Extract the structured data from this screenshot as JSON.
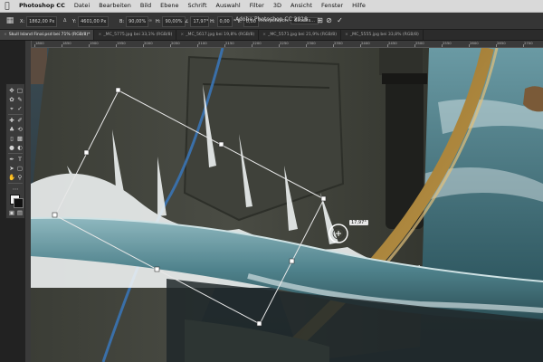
{
  "menubar": {
    "app": "Photoshop CC",
    "items": [
      "Datei",
      "Bearbeiten",
      "Bild",
      "Ebene",
      "Schrift",
      "Auswahl",
      "Filter",
      "3D",
      "Ansicht",
      "Fenster",
      "Hilfe"
    ]
  },
  "options": {
    "x_label": "X:",
    "x_value": "1862,00 Px",
    "delta": "Δ",
    "y_label": "Y:",
    "y_value": "4601,00 Px",
    "w_label": "B:",
    "w_value": "90,00%",
    "link": "∞",
    "h_label": "H:",
    "h_value": "90,00%",
    "angle_label": "∠",
    "angle_value": "17,97",
    "hskew_label": "°  H:",
    "hskew_value": "0,00",
    "vskew_label": "°  V:",
    "vskew_value": "0,00",
    "interp_label": "Interpolation:",
    "interp_value": "Bikubis..."
  },
  "document_title": "Adobe Photoshop CC 2018",
  "tabs": [
    "Skull Island Final.psd bei 71% (RGB/8)*",
    "_MC_5775.jpg bei 33,1% (RGB/8)",
    "_MC_5617.jpg bei 19,8% (RGB/8)",
    "_MC_5571.jpg bei 21,9% (RGB/8)",
    "_MC_5555.jpg bei 33,8% (RGB/8)"
  ],
  "ruler": {
    "ticks": [
      "1800",
      "1850",
      "1900",
      "1950",
      "2000",
      "2050",
      "2100",
      "2150",
      "2200",
      "2250",
      "2300",
      "2350",
      "2400",
      "2450",
      "2500",
      "2550",
      "2600",
      "2650",
      "2700"
    ]
  },
  "canvas": {
    "rotation_readout": "17,97°"
  },
  "colors": {
    "menubar_bg": "#d9d9d9",
    "chrome_dark": "#353535",
    "water": "#3f6e78"
  },
  "icons": {
    "apple": "apple-logo-icon",
    "confirm": "checkmark-icon",
    "cancel": "cancel-icon",
    "warp": "warp-icon"
  }
}
